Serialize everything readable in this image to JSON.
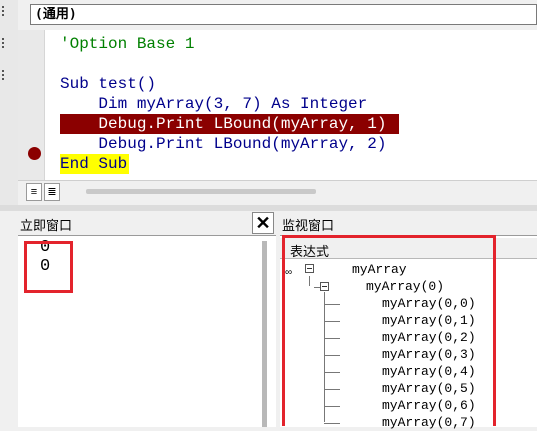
{
  "code_window": {
    "object_combo": "(通用)",
    "lines": [
      {
        "text": "'Option Base 1",
        "style": "comment"
      },
      {
        "text": "",
        "style": "plain"
      },
      {
        "text": "Sub test()",
        "style": "keyword"
      },
      {
        "text": "    Dim myArray(3, 7) As Integer",
        "style": "keyword"
      },
      {
        "text": "    Debug.Print LBound(myArray, 1)",
        "style": "breakpoint"
      },
      {
        "text": "    Debug.Print LBound(myArray, 2)",
        "style": "keyword"
      },
      {
        "text": "End Sub",
        "style": "current"
      }
    ],
    "view_buttons": [
      "≡",
      "≣"
    ]
  },
  "immediate_window": {
    "title": "立即窗口",
    "close_label": "✕",
    "output": [
      "0",
      "0"
    ]
  },
  "watch_window": {
    "title": "监视窗口",
    "header": "表达式",
    "root": "myArray",
    "child": "myArray(0)",
    "items": [
      "myArray(0,0)",
      "myArray(0,1)",
      "myArray(0,2)",
      "myArray(0,3)",
      "myArray(0,4)",
      "myArray(0,5)",
      "myArray(0,6)",
      "myArray(0,7)"
    ]
  },
  "colors": {
    "breakpoint": "#8b0000",
    "current_line": "#ffff00",
    "annotation_box": "#e3232c",
    "keyword": "#00008b",
    "comment": "#008000"
  }
}
